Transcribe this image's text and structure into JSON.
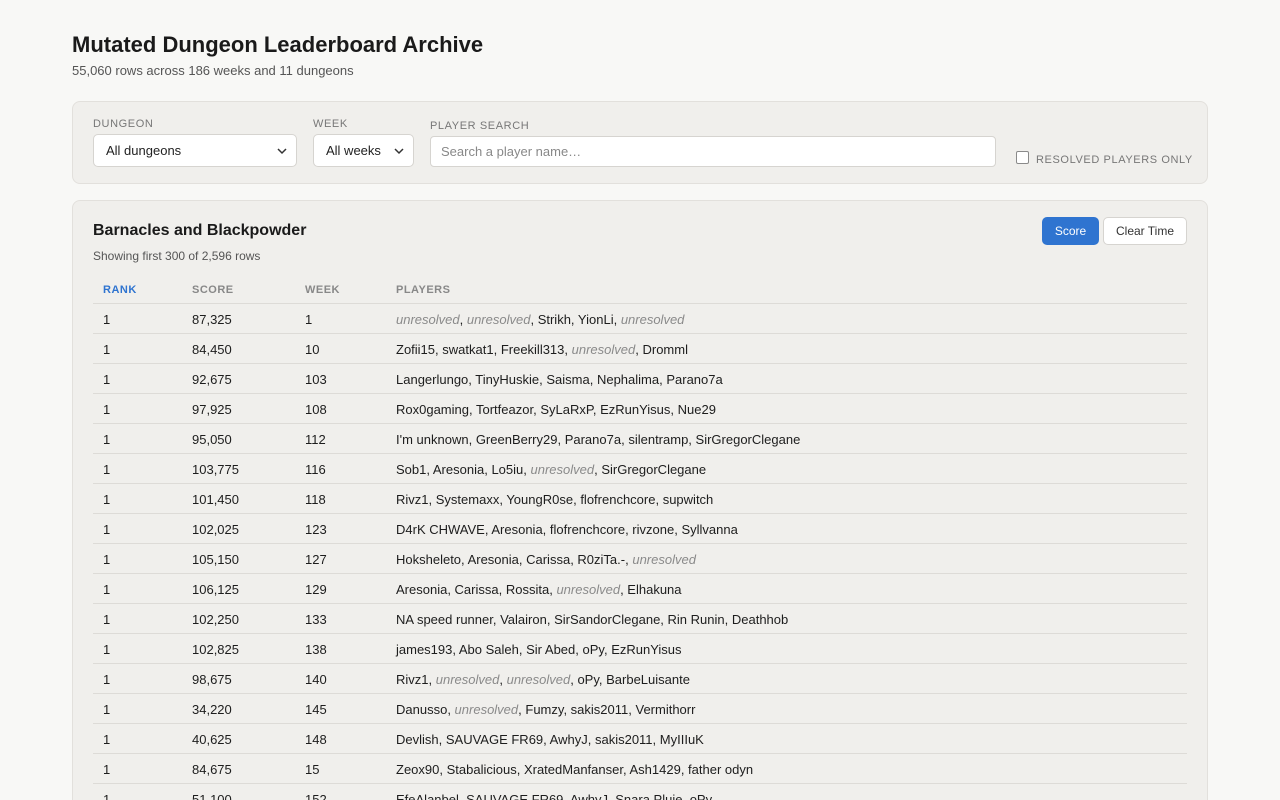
{
  "header": {
    "title": "Mutated Dungeon Leaderboard Archive",
    "subtitle": "55,060 rows across 186 weeks and 11 dungeons"
  },
  "filters": {
    "dungeon_label": "DUNGEON",
    "dungeon_value": "All dungeons",
    "week_label": "WEEK",
    "week_value": "All weeks",
    "search_label": "PLAYER SEARCH",
    "search_placeholder": "Search a player name…",
    "resolved_label": "RESOLVED PLAYERS ONLY",
    "resolved_checked": false
  },
  "panel": {
    "title": "Barnacles and Blackpowder",
    "subtitle": "Showing first 300 of 2,596 rows",
    "score_button": "Score",
    "clear_time_button": "Clear Time",
    "active_sort": "Score"
  },
  "table": {
    "columns": [
      "RANK",
      "SCORE",
      "WEEK",
      "PLAYERS"
    ],
    "sorted_column": "RANK",
    "rows": [
      {
        "rank": "1",
        "score": "87,325",
        "week": "1",
        "players": [
          "unresolved",
          "unresolved",
          "Strikh",
          "YionLi",
          "unresolved"
        ]
      },
      {
        "rank": "1",
        "score": "84,450",
        "week": "10",
        "players": [
          "Zofii15",
          "swatkat1",
          "Freekill313",
          "unresolved",
          "Dromml"
        ]
      },
      {
        "rank": "1",
        "score": "92,675",
        "week": "103",
        "players": [
          "Langerlungo",
          "TinyHuskie",
          "Saisma",
          "Nephalima",
          "Parano7a"
        ]
      },
      {
        "rank": "1",
        "score": "97,925",
        "week": "108",
        "players": [
          "Rox0gaming",
          "Tortfeazor",
          "SyLaRxP",
          "EzRunYisus",
          "Nue29"
        ]
      },
      {
        "rank": "1",
        "score": "95,050",
        "week": "112",
        "players": [
          "I'm unknown",
          "GreenBerry29",
          "Parano7a",
          "silentramp",
          "SirGregorClegane"
        ]
      },
      {
        "rank": "1",
        "score": "103,775",
        "week": "116",
        "players": [
          "Sob1",
          "Aresonia",
          "Lo5iu",
          "unresolved",
          "SirGregorClegane"
        ]
      },
      {
        "rank": "1",
        "score": "101,450",
        "week": "118",
        "players": [
          "Rivz1",
          "Systemaxx",
          "YoungR0se",
          "flofrenchcore",
          "supwitch"
        ]
      },
      {
        "rank": "1",
        "score": "102,025",
        "week": "123",
        "players": [
          "D4rK CHWAVE",
          "Aresonia",
          "flofrenchcore",
          "rivzone",
          "Syllvanna"
        ]
      },
      {
        "rank": "1",
        "score": "105,150",
        "week": "127",
        "players": [
          "Hoksheleto",
          "Aresonia",
          "Carissa",
          "R0ziTa.-",
          "unresolved"
        ]
      },
      {
        "rank": "1",
        "score": "106,125",
        "week": "129",
        "players": [
          "Aresonia",
          "Carissa",
          "Rossita",
          "unresolved",
          "Elhakuna"
        ]
      },
      {
        "rank": "1",
        "score": "102,250",
        "week": "133",
        "players": [
          "NA speed runner",
          "Valairon",
          "SirSandorClegane",
          "Rin Runin",
          "Deathhob"
        ]
      },
      {
        "rank": "1",
        "score": "102,825",
        "week": "138",
        "players": [
          "james193",
          "Abo Saleh",
          "Sir Abed",
          "oPy",
          "EzRunYisus"
        ]
      },
      {
        "rank": "1",
        "score": "98,675",
        "week": "140",
        "players": [
          "Rivz1",
          "unresolved",
          "unresolved",
          "oPy",
          "BarbeLuisante"
        ]
      },
      {
        "rank": "1",
        "score": "34,220",
        "week": "145",
        "players": [
          "Danusso",
          "unresolved",
          "Fumzy",
          "sakis2011",
          "Vermithorr"
        ]
      },
      {
        "rank": "1",
        "score": "40,625",
        "week": "148",
        "players": [
          "Devlish",
          "SAUVAGE FR69",
          "AwhyJ",
          "sakis2011",
          "MyIIIuK"
        ]
      },
      {
        "rank": "1",
        "score": "84,675",
        "week": "15",
        "players": [
          "Zeox90",
          "Stabalicious",
          "XratedManfanser",
          "Ash1429",
          "father odyn"
        ]
      },
      {
        "rank": "1",
        "score": "51,100",
        "week": "152",
        "players": [
          "EfeAlanbel",
          "SAUVAGE FR69",
          "AwhyJ",
          "Snara Pluie",
          "oPy"
        ]
      }
    ]
  },
  "colors": {
    "accent": "#2f74d0",
    "unresolved_text": "#8a8a8a",
    "panel_bg": "#f0efec",
    "page_bg": "#f8f8f6"
  },
  "icons": {
    "dungeon_select": "chevron-down-icon",
    "week_select": "chevron-down-icon"
  }
}
